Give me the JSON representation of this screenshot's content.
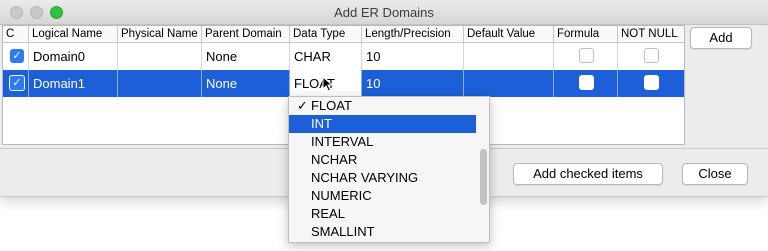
{
  "window": {
    "title": "Add ER Domains"
  },
  "table": {
    "headers": [
      "C",
      "Logical Name",
      "Physical Name",
      "Parent Domain",
      "Data Type",
      "Length/Precision",
      "Default Value",
      "Formula",
      "NOT NULL"
    ],
    "rows": [
      {
        "checked": true,
        "logical_name": "Domain0",
        "physical_name": "",
        "parent_domain": "None",
        "data_type": "CHAR",
        "length": "10",
        "default_value": "",
        "formula": false,
        "not_null": false,
        "selected": false
      },
      {
        "checked": true,
        "logical_name": "Domain1",
        "physical_name": "",
        "parent_domain": "None",
        "data_type": "FLOAT",
        "length": "10",
        "default_value": "",
        "formula": false,
        "not_null": false,
        "selected": true
      }
    ]
  },
  "buttons": {
    "add": "Add",
    "add_checked": "Add checked items",
    "close": "Close"
  },
  "dropdown": {
    "selected": "FLOAT",
    "highlighted": "INT",
    "check_glyph": "✓",
    "items": [
      "FLOAT",
      "INT",
      "INTERVAL",
      "NCHAR",
      "NCHAR VARYING",
      "NUMERIC",
      "REAL",
      "SMALLINT"
    ]
  },
  "colors": {
    "selection": "#1c5fd8",
    "checkbox": "#2a7cf0",
    "traffic_max": "#2dc33e"
  }
}
